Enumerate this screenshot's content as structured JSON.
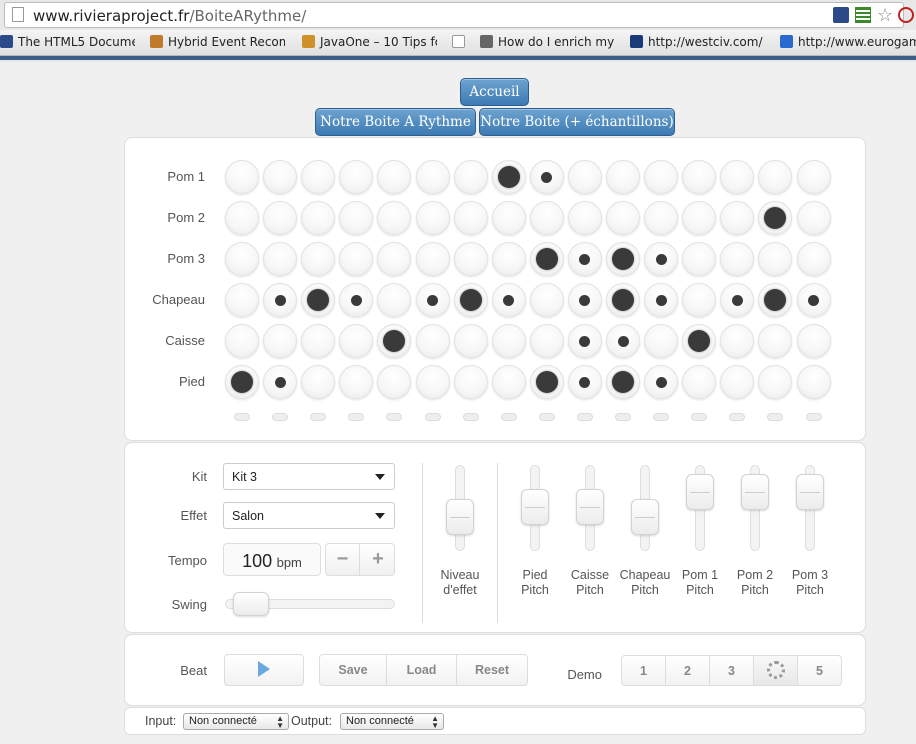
{
  "browser": {
    "url_domain": "www.rivieraproject.fr",
    "url_path": "/BoiteARythme/",
    "bookmarks": [
      {
        "label": "The HTML5 Docume",
        "icon": "app-icon",
        "color": "#2a4a8a"
      },
      {
        "label": "Hybrid Event Recomm",
        "icon": "puzzle-icon",
        "color": "#c07a2a"
      },
      {
        "label": "JavaOne – 10 Tips fo",
        "icon": "puzzle-icon",
        "color": "#d0902a"
      },
      {
        "label": "",
        "icon": "page-icon",
        "color": "#ffffff"
      },
      {
        "label": "How do I enrich my",
        "icon": "grid-icon",
        "color": "#666666"
      },
      {
        "label": "http://westciv.com/",
        "icon": "w-logo-icon",
        "color": "#1a3a7a"
      },
      {
        "label": "http://www.eurogam",
        "icon": "globe-icon",
        "color": "#2a6ad0"
      }
    ]
  },
  "nav": {
    "home": "Accueil",
    "rhythm_box": "Notre Boite A Rythme",
    "rhythm_box_samples": "Notre Boite (+ échantillons)"
  },
  "sequencer": {
    "rows": [
      {
        "label": "Pom 1",
        "steps": [
          0,
          0,
          0,
          0,
          0,
          0,
          0,
          2,
          1,
          0,
          0,
          0,
          0,
          0,
          0,
          0
        ]
      },
      {
        "label": "Pom 2",
        "steps": [
          0,
          0,
          0,
          0,
          0,
          0,
          0,
          0,
          0,
          0,
          0,
          0,
          0,
          0,
          2,
          0
        ]
      },
      {
        "label": "Pom 3",
        "steps": [
          0,
          0,
          0,
          0,
          0,
          0,
          0,
          0,
          2,
          1,
          2,
          1,
          0,
          0,
          0,
          0
        ]
      },
      {
        "label": "Chapeau",
        "steps": [
          0,
          1,
          2,
          1,
          0,
          1,
          2,
          1,
          0,
          1,
          2,
          1,
          0,
          1,
          2,
          1
        ]
      },
      {
        "label": "Caisse",
        "steps": [
          0,
          0,
          0,
          0,
          2,
          0,
          0,
          0,
          0,
          1,
          1,
          0,
          2,
          0,
          0,
          0
        ]
      },
      {
        "label": "Pied",
        "steps": [
          2,
          1,
          0,
          0,
          0,
          0,
          0,
          0,
          2,
          1,
          2,
          1,
          0,
          0,
          0,
          0
        ]
      }
    ],
    "step_count": 16
  },
  "controls": {
    "kit_label": "Kit",
    "kit_value": "Kit 3",
    "effect_label": "Effet",
    "effect_value": "Salon",
    "tempo_label": "Tempo",
    "tempo_value": "100",
    "tempo_unit": "bpm",
    "tempo_minus": "−",
    "tempo_plus": "+",
    "swing_label": "Swing",
    "swing_level": 0.05
  },
  "sliders": [
    {
      "label_line1": "Niveau",
      "label_line2": "d'effet",
      "level": 0.35
    },
    {
      "label_line1": "Pied",
      "label_line2": "Pitch",
      "level": 0.55
    },
    {
      "label_line1": "Caisse",
      "label_line2": "Pitch",
      "level": 0.55
    },
    {
      "label_line1": "Chapeau",
      "label_line2": "Pitch",
      "level": 0.35
    },
    {
      "label_line1": "Pom 1",
      "label_line2": "Pitch",
      "level": 0.85
    },
    {
      "label_line1": "Pom 2",
      "label_line2": "Pitch",
      "level": 0.85
    },
    {
      "label_line1": "Pom 3",
      "label_line2": "Pitch",
      "level": 0.85
    }
  ],
  "transport": {
    "beat_label": "Beat",
    "save": "Save",
    "load": "Load",
    "reset": "Reset",
    "demo_label": "Demo",
    "demos": [
      "1",
      "2",
      "3",
      "",
      "5"
    ]
  },
  "midi": {
    "input_label": "Input:",
    "input_value": "Non connecté",
    "output_label": "Output:",
    "output_value": "Non connecté"
  }
}
